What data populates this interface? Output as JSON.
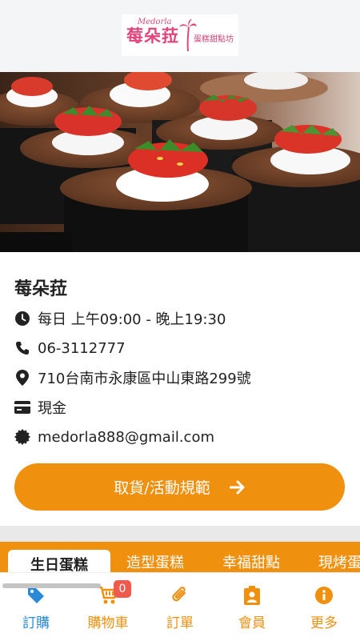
{
  "header": {
    "logo_main": "莓朵菈",
    "logo_en": "Medorla",
    "logo_sub": "蛋糕甜點坊"
  },
  "store": {
    "name": "莓朵菈",
    "hours": "每日 上午09:00 - 晚上19:30",
    "phone": "06-3112777",
    "address": "710台南市永康區中山東路299號",
    "payment": "現金",
    "email": "medorla888@gmail.com",
    "rules_button": "取貨/活動規範"
  },
  "category_tabs": [
    "生日蛋糕",
    "造型蛋糕",
    "幸福甜點",
    "現烤蛋"
  ],
  "bottom_nav": {
    "order": "訂購",
    "cart": "購物車",
    "cart_count": "0",
    "orders": "訂單",
    "member": "會員",
    "more": "更多"
  },
  "colors": {
    "accent": "#f0900f",
    "active_nav": "#2a8ad8",
    "badge": "#ef5a4d",
    "brand_pink": "#e0457b"
  }
}
